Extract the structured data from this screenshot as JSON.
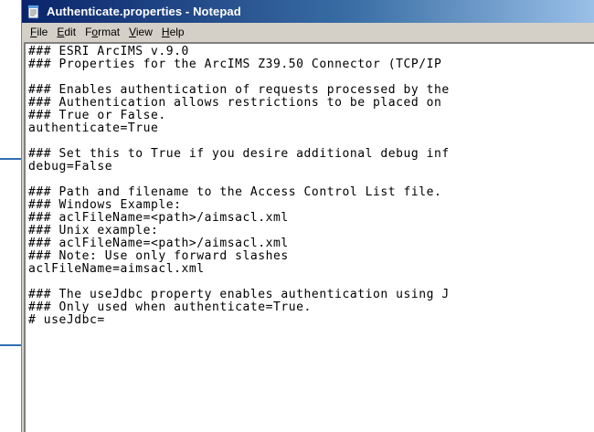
{
  "window": {
    "title": "Authenticate.properties - Notepad",
    "app_icon": "notepad-icon"
  },
  "menu": {
    "items": [
      {
        "mnemonic": "F",
        "rest": "ile"
      },
      {
        "mnemonic": "E",
        "rest": "dit"
      },
      {
        "mnemonic": "",
        "rest": "F",
        "mid": "o",
        "tail": "rmat"
      },
      {
        "mnemonic": "V",
        "rest": "iew"
      },
      {
        "mnemonic": "H",
        "rest": "elp"
      }
    ]
  },
  "editor": {
    "lines": [
      "### ESRI ArcIMS v.9.0",
      "### Properties for the ArcIMS Z39.50 Connector (TCP/IP",
      "",
      "### Enables authentication of requests processed by the",
      "### Authentication allows restrictions to be placed on",
      "### True or False.",
      "authenticate=True",
      "",
      "### Set this to True if you desire additional debug inf",
      "debug=False",
      "",
      "### Path and filename to the Access Control List file.",
      "### Windows Example:",
      "### aclFileName=<path>/aimsacl.xml",
      "### Unix example:",
      "### aclFileName=<path>/aimsacl.xml",
      "### Note: Use only forward slashes",
      "aclFileName=aimsacl.xml",
      "",
      "### The useJdbc property enables authentication using J",
      "### Only used when authenticate=True.",
      "# useJdbc="
    ]
  },
  "colors": {
    "titlebar_start": "#0a246a",
    "titlebar_end": "#a6caf0",
    "callout": "#2f6fb3",
    "chrome": "#d4d0c8"
  }
}
